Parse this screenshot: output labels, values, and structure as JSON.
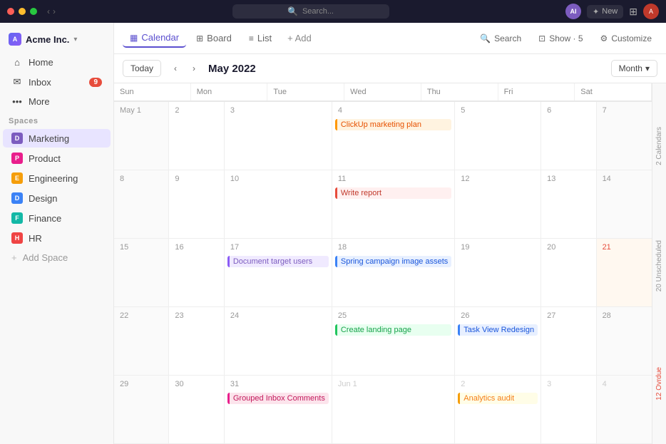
{
  "titlebar": {
    "search_placeholder": "Search...",
    "ai_label": "AI",
    "new_label": "New"
  },
  "sidebar": {
    "logo": {
      "text": "Acme Inc.",
      "caret": "▾"
    },
    "nav_items": [
      {
        "id": "home",
        "label": "Home",
        "icon": "⌂"
      },
      {
        "id": "inbox",
        "label": "Inbox",
        "icon": "✉",
        "badge": "9"
      },
      {
        "id": "more",
        "label": "More",
        "icon": "···"
      }
    ],
    "spaces_label": "Spaces",
    "spaces": [
      {
        "id": "marketing",
        "label": "Marketing",
        "abbr": "D",
        "color": "bg-purple",
        "active": true
      },
      {
        "id": "product",
        "label": "Product",
        "abbr": "P",
        "color": "bg-pink"
      },
      {
        "id": "engineering",
        "label": "Engineering",
        "abbr": "E",
        "color": "bg-yellow"
      },
      {
        "id": "design",
        "label": "Design",
        "abbr": "D",
        "color": "bg-blue"
      },
      {
        "id": "finance",
        "label": "Finance",
        "abbr": "F",
        "color": "bg-teal"
      },
      {
        "id": "hr",
        "label": "HR",
        "abbr": "H",
        "color": "bg-red"
      }
    ],
    "add_space": "Add Space"
  },
  "view_tabs": [
    {
      "id": "calendar",
      "label": "Calendar",
      "icon": "▦",
      "active": true
    },
    {
      "id": "board",
      "label": "Board",
      "icon": "⊞"
    },
    {
      "id": "list",
      "label": "List",
      "icon": "≡"
    }
  ],
  "view_add": "+ Add",
  "toolbar": {
    "search": "Search",
    "show": "Show · 5",
    "customize": "Customize"
  },
  "calendar": {
    "today_btn": "Today",
    "title": "May 2022",
    "month_label": "Month",
    "days": [
      "Sun",
      "Mon",
      "Tue",
      "Wed",
      "Thu",
      "Fri",
      "Sat"
    ],
    "right_sidebar": {
      "calendars": "2 Calendars",
      "unscheduled": "20 Unscheduled",
      "overdue": "12 Ovrdue"
    }
  },
  "events": {
    "clickup_marketing": "ClickUp marketing plan",
    "write_report": "Write report",
    "document_target": "Document target users",
    "spring_campaign": "Spring campaign image assets",
    "create_landing": "Create landing page",
    "task_view": "Task View Redesign",
    "grouped_inbox": "Grouped Inbox Comments",
    "analytics_audit": "Analytics audit"
  }
}
